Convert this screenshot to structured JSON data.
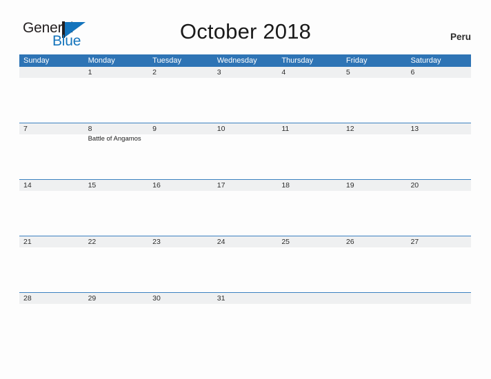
{
  "brand": {
    "name_part1": "General",
    "name_part2": "Blue",
    "mark": "triangle-flag-logo",
    "color_primary": "#1474bc",
    "color_text": "#231f20"
  },
  "header": {
    "title": "October 2018",
    "region": "Peru"
  },
  "theme": {
    "header_blue": "#2e74b5",
    "row_line_blue": "#3a80c0",
    "band_gray": "#eff0f1",
    "page_background": "#fdfdfd"
  },
  "calendar": {
    "weekdays": [
      "Sunday",
      "Monday",
      "Tuesday",
      "Wednesday",
      "Thursday",
      "Friday",
      "Saturday"
    ],
    "weeks": [
      {
        "days": [
          {
            "number": "",
            "events": []
          },
          {
            "number": "1",
            "events": []
          },
          {
            "number": "2",
            "events": []
          },
          {
            "number": "3",
            "events": []
          },
          {
            "number": "4",
            "events": []
          },
          {
            "number": "5",
            "events": []
          },
          {
            "number": "6",
            "events": []
          }
        ]
      },
      {
        "days": [
          {
            "number": "7",
            "events": []
          },
          {
            "number": "8",
            "events": [
              "Battle of Angamos"
            ]
          },
          {
            "number": "9",
            "events": []
          },
          {
            "number": "10",
            "events": []
          },
          {
            "number": "11",
            "events": []
          },
          {
            "number": "12",
            "events": []
          },
          {
            "number": "13",
            "events": []
          }
        ]
      },
      {
        "days": [
          {
            "number": "14",
            "events": []
          },
          {
            "number": "15",
            "events": []
          },
          {
            "number": "16",
            "events": []
          },
          {
            "number": "17",
            "events": []
          },
          {
            "number": "18",
            "events": []
          },
          {
            "number": "19",
            "events": []
          },
          {
            "number": "20",
            "events": []
          }
        ]
      },
      {
        "days": [
          {
            "number": "21",
            "events": []
          },
          {
            "number": "22",
            "events": []
          },
          {
            "number": "23",
            "events": []
          },
          {
            "number": "24",
            "events": []
          },
          {
            "number": "25",
            "events": []
          },
          {
            "number": "26",
            "events": []
          },
          {
            "number": "27",
            "events": []
          }
        ]
      },
      {
        "days": [
          {
            "number": "28",
            "events": []
          },
          {
            "number": "29",
            "events": []
          },
          {
            "number": "30",
            "events": []
          },
          {
            "number": "31",
            "events": []
          },
          {
            "number": "",
            "events": []
          },
          {
            "number": "",
            "events": []
          },
          {
            "number": "",
            "events": []
          }
        ]
      }
    ]
  }
}
